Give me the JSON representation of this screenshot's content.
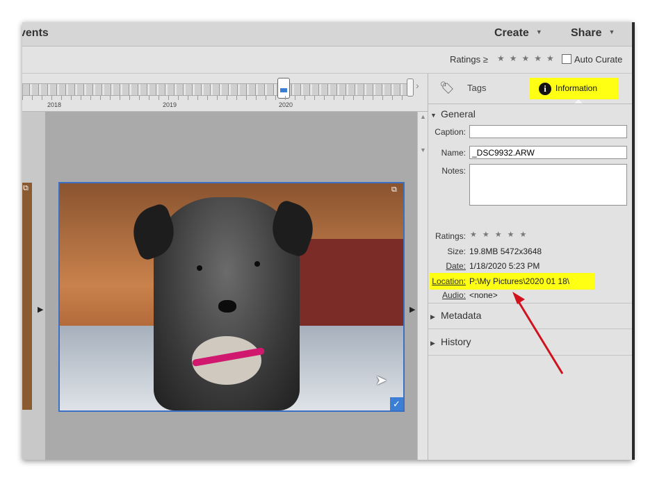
{
  "app": {
    "title": "vents"
  },
  "menus": {
    "create": "Create",
    "share": "Share"
  },
  "filter": {
    "ratings_label": "Ratings",
    "ratings_op": "≥",
    "ratings_stars": "★★★★★",
    "auto_curate": "Auto Curate",
    "auto_curate_checked": false
  },
  "timeline": {
    "years": [
      "2018",
      "2019",
      "2020"
    ]
  },
  "panel": {
    "tabs": {
      "tags": "Tags",
      "information": "Information"
    },
    "general": {
      "header": "General",
      "caption_label": "Caption:",
      "caption_value": "",
      "name_label": "Name:",
      "name_value": "_DSC9932.ARW",
      "notes_label": "Notes:",
      "notes_value": "",
      "ratings_label": "Ratings:",
      "ratings_stars": "★★★★★",
      "size_label": "Size:",
      "size_value": "19.8MB  5472x3648",
      "date_label": "Date:",
      "date_value": "1/18/2020 5:23 PM",
      "location_label": "Location:",
      "location_value": "P:\\My Pictures\\2020 01 18\\",
      "audio_label": "Audio:",
      "audio_value": "<none>"
    },
    "metadata_header": "Metadata",
    "history_header": "History"
  },
  "colors": {
    "highlight": "#ffff14",
    "selection": "#3b6fc4",
    "arrow": "#d0121e"
  }
}
